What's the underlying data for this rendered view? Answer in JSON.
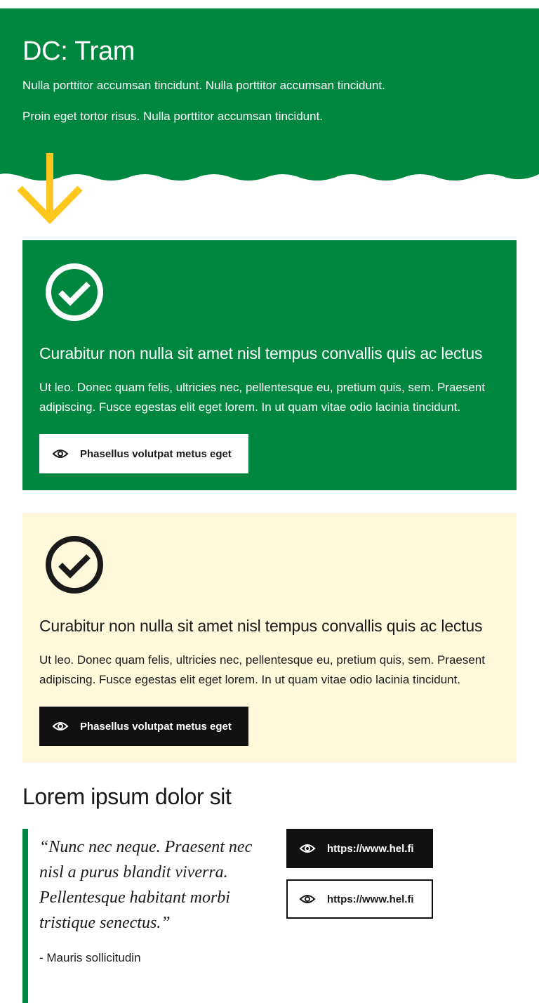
{
  "colors": {
    "brand_green": "#00873f",
    "accent_yellow": "#ffc61e",
    "cream": "#fff8da",
    "dark": "#111111"
  },
  "hero": {
    "title": "DC: Tram",
    "paragraph_1": "Nulla porttitor accumsan tincidunt. Nulla porttitor accumsan tincidunt.",
    "paragraph_2": "Proin eget tortor risus. Nulla porttitor accumsan tincidunt.",
    "arrow_icon": "arrow-down-icon"
  },
  "cards": [
    {
      "variant": "green",
      "icon": "check-circle-icon",
      "title": "Curabitur non nulla sit amet nisl tempus convallis quis ac lectus",
      "text": "Ut leo. Donec quam felis, ultricies nec, pellentesque eu, pretium quis, sem. Praesent adipiscing. Fusce egestas elit eget lorem. In ut quam vitae odio lacinia tincidunt.",
      "button_label": "Phasellus volutpat metus eget",
      "button_icon": "eye-icon"
    },
    {
      "variant": "cream",
      "icon": "check-circle-icon",
      "title": "Curabitur non nulla sit amet nisl tempus convallis quis ac lectus",
      "text": "Ut leo. Donec quam felis, ultricies nec, pellentesque eu, pretium quis, sem. Praesent adipiscing. Fusce egestas elit eget lorem. In ut quam vitae odio lacinia tincidunt.",
      "button_label": "Phasellus volutpat metus eget",
      "button_icon": "eye-icon"
    }
  ],
  "section": {
    "title": "Lorem ipsum dolor sit",
    "quote": "“Nunc nec neque. Praesent nec nisl a purus blandit viverra. Pellentesque habitant morbi tristique senectus.”",
    "author": "- Mauris sollicitudin",
    "links": [
      {
        "label": "https://www.hel.fi",
        "style": "dark",
        "icon": "eye-icon"
      },
      {
        "label": "https://www.hel.fi",
        "style": "outline",
        "icon": "eye-icon"
      }
    ]
  }
}
